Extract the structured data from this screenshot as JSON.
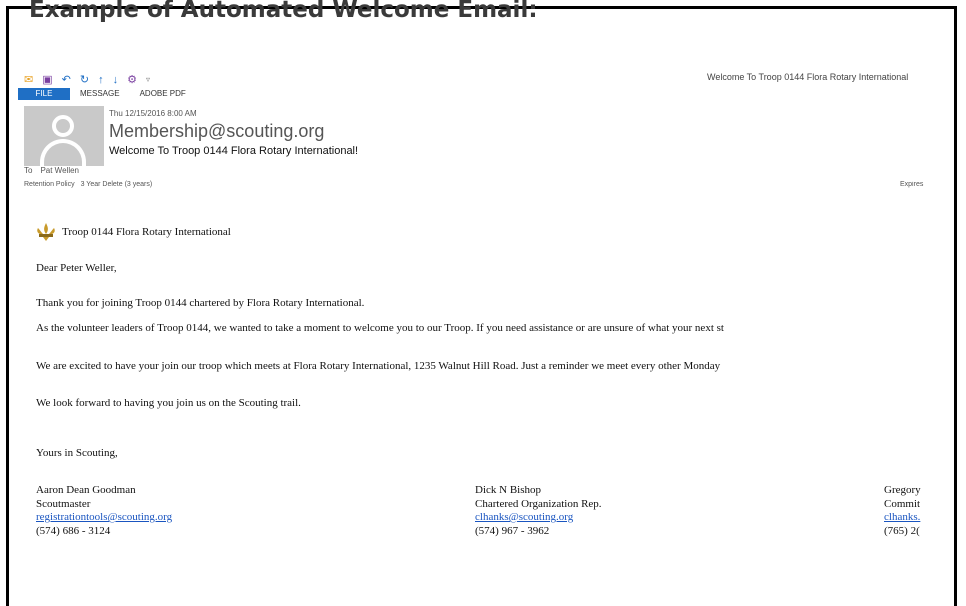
{
  "heading": "Example of Automated Welcome Email:",
  "window_title": "Welcome To Troop 0144 Flora Rotary International",
  "qat_icons": [
    "mail-icon",
    "save-icon",
    "undo-icon",
    "redo-icon",
    "up-arrow-icon",
    "down-arrow-icon",
    "customize-icon",
    "dropdown-icon"
  ],
  "ribbon_tabs": [
    "FILE",
    "MESSAGE",
    "ADOBE PDF"
  ],
  "header": {
    "date": "Thu 12/15/2016 8:00 AM",
    "sender": "Membership@scouting.org",
    "subject": "Welcome To Troop 0144 Flora Rotary International!",
    "to_label": "To",
    "to_name": "Pat Wellen",
    "retention_label": "Retention Policy",
    "retention_value": "3 Year Delete (3 years)",
    "expires_label": "Expires"
  },
  "body": {
    "troop_name": "Troop 0144 Flora Rotary International",
    "greeting": "Dear Peter Weller,",
    "para1": "Thank you for joining Troop 0144 chartered by Flora Rotary International.",
    "para2": "As the volunteer leaders of Troop 0144, we wanted to take a moment to welcome you to our Troop. If you need assistance or are unsure of what your next st",
    "para3": "We are excited to have your join our troop which meets at Flora Rotary International, 1235 Walnut Hill Road.  Just a reminder we meet every other Monday",
    "para4": "We look forward to having you join us on the Scouting trail.",
    "closing": "Yours in Scouting,"
  },
  "signatures": [
    {
      "name": "Aaron Dean Goodman",
      "role": "Scoutmaster",
      "email": "registrationtools@scouting.org",
      "phone": "(574) 686 - 3124"
    },
    {
      "name": "Dick N Bishop",
      "role": "Chartered Organization Rep.",
      "email": "clhanks@scouting.org",
      "phone": "(574) 967 - 3962"
    },
    {
      "name": "Gregory",
      "role": "Commit",
      "email": "clhanks.",
      "phone": "(765) 2("
    }
  ],
  "colors": {
    "file_tab": "#1f6fc5",
    "link": "#1a55c0",
    "heading": "#3a3a3a"
  }
}
